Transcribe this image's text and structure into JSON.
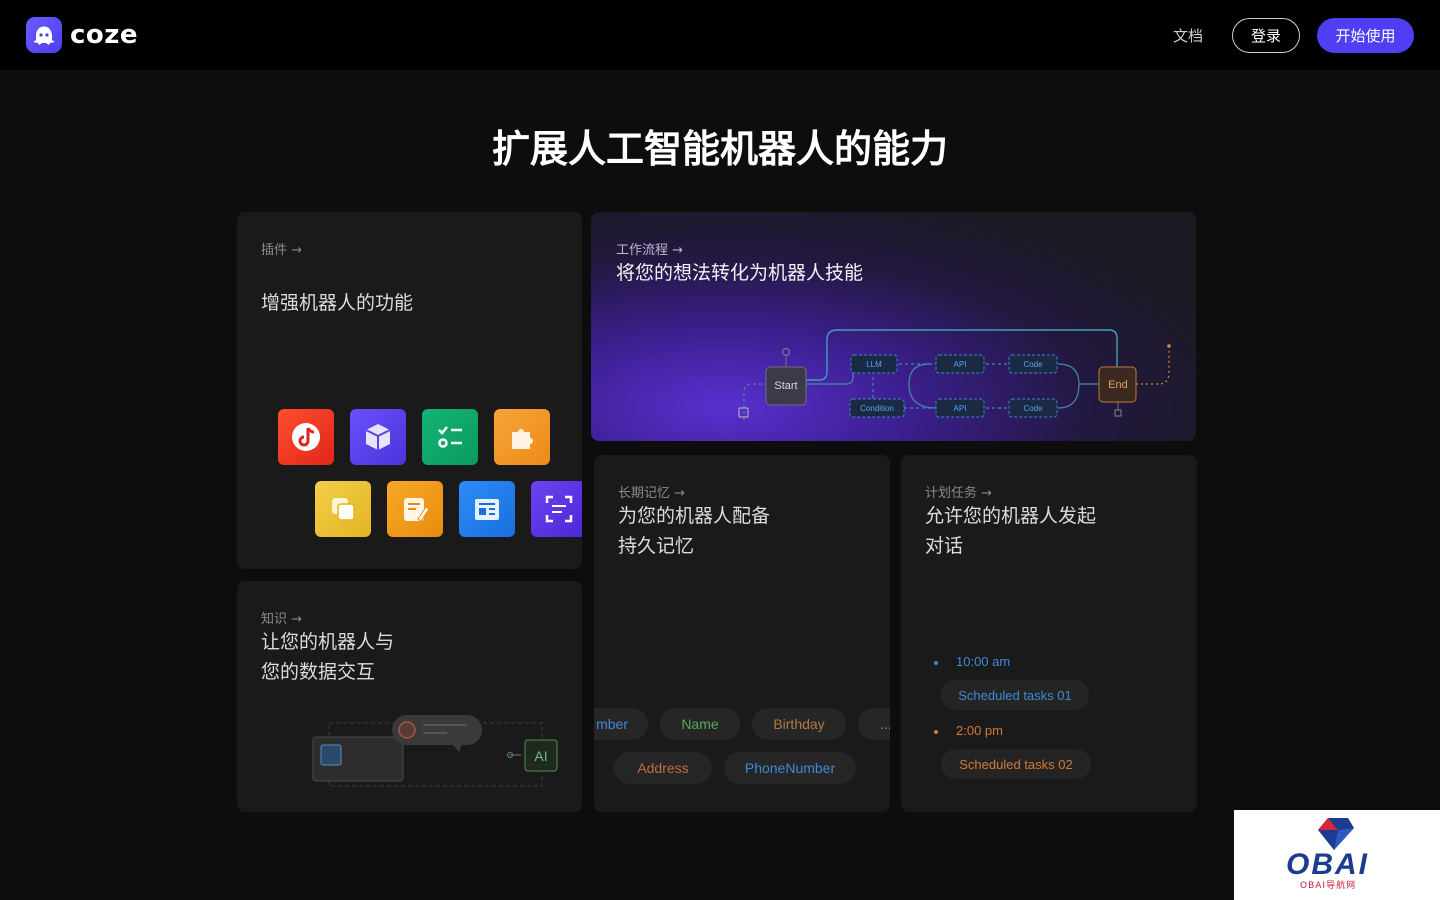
{
  "header": {
    "brand": "coze",
    "nav_docs": "文档",
    "login": "登录",
    "start": "开始使用"
  },
  "page_title": "扩展人工智能机器人的能力",
  "cards": {
    "plugin": {
      "tag": "插件 →",
      "title": "增强机器人的功能"
    },
    "workflow": {
      "tag": "工作流程 →",
      "title": "将您的想法转化为机器人技能",
      "nodes": {
        "start": "Start",
        "llm": "LLM",
        "api1": "API",
        "code1": "Code",
        "condition": "Condition",
        "api2": "API",
        "code2": "Code",
        "end": "End"
      }
    },
    "knowledge": {
      "tag": "知识 →",
      "title_line1": "让您的机器人与",
      "title_line2": "您的数据交互",
      "ai_label": "AI"
    },
    "memory": {
      "tag": "长期记忆 →",
      "title_line1": "为您的机器人配备",
      "title_line2": "持久记忆",
      "fields_row1": [
        "mber",
        "Name",
        "Birthday",
        "..."
      ],
      "fields_row2": [
        "Address",
        "PhoneNumber"
      ]
    },
    "schedule": {
      "tag": "计划任务 →",
      "title_line1": "允许您的机器人发起",
      "title_line2": "对话",
      "tasks": [
        {
          "time": "10:00 am",
          "label": "Scheduled tasks 01"
        },
        {
          "time": "2:00 pm",
          "label": "Scheduled tasks 02"
        }
      ]
    }
  },
  "colors": {
    "accent": "#4f3ef4",
    "blue_text": "#3f8ad6",
    "orange_text": "#d07a3a",
    "green_text": "#5aa65e"
  },
  "icons": {
    "plugin_apps": [
      "tiktok-icon",
      "cube-icon",
      "checklist-icon",
      "puzzle-icon",
      "layers-icon",
      "notes-icon",
      "news-icon",
      "scan-icon"
    ]
  },
  "watermark": {
    "text": "OBAI",
    "sub": "OBAI导航网"
  }
}
